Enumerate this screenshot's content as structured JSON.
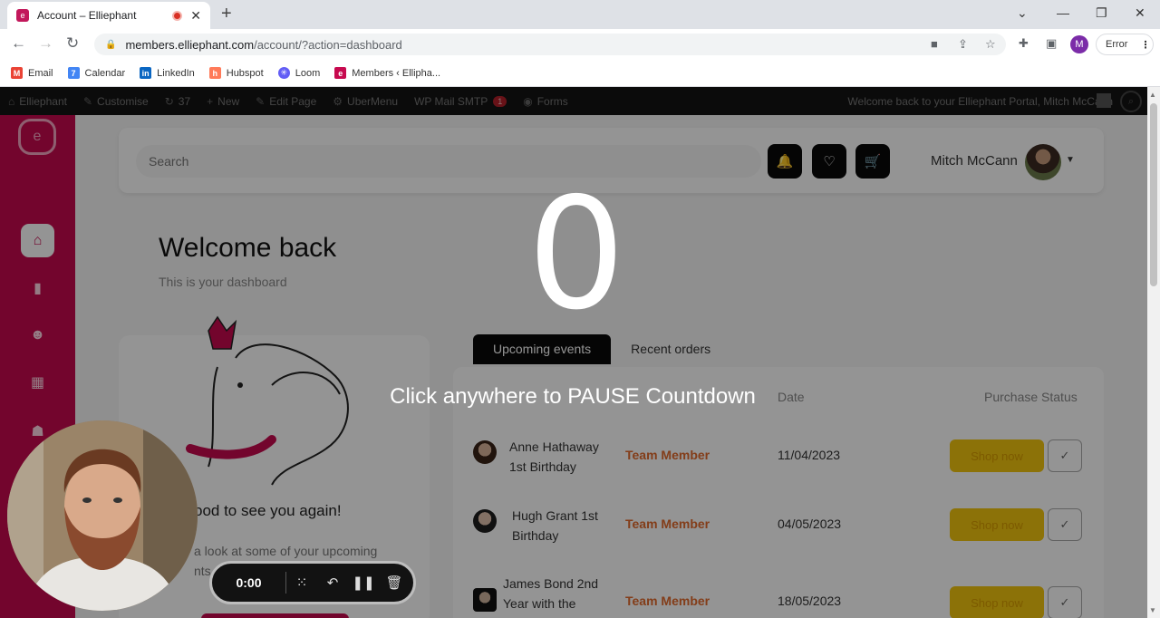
{
  "browser": {
    "tab_title": "Account – Elliephant",
    "new_tab": "+",
    "url_host": "members.elliephant.com",
    "url_path": "/account/?action=dashboard",
    "profile_initial": "M",
    "error_label": "Error",
    "bookmarks": [
      {
        "label": "Email",
        "icon": "gmail-icon",
        "color": "#ea4335"
      },
      {
        "label": "Calendar",
        "icon": "calendar-icon",
        "color": "#4285f4"
      },
      {
        "label": "LinkedIn",
        "icon": "linkedin-icon",
        "color": "#0a66c2"
      },
      {
        "label": "Hubspot",
        "icon": "hubspot-icon",
        "color": "#ff7a59"
      },
      {
        "label": "Loom",
        "icon": "loom-icon",
        "color": "#625df5"
      },
      {
        "label": "Members ‹ Ellipha...",
        "icon": "elliephant-icon",
        "color": "#c70a4f"
      }
    ]
  },
  "wp_admin_bar": {
    "site": "Elliephant",
    "customise": "Customise",
    "updates": "37",
    "new": "New",
    "edit_page": "Edit Page",
    "ubermenu": "UberMenu",
    "wp_mail_smtp": "WP Mail SMTP",
    "wp_mail_count": "1",
    "forms": "Forms",
    "welcome": "Welcome back to your Elliephant Portal, Mitch McCann"
  },
  "header": {
    "search_placeholder": "Search",
    "user_name": "Mitch McCann"
  },
  "main": {
    "welcome_title": "Welcome back",
    "welcome_subtitle": "This is your dashboard",
    "good_to_see": "ood to see you again!",
    "look_at": "a look at some of your upcoming",
    "look_at_2": "nts an"
  },
  "events": {
    "tabs": [
      "Upcoming events",
      "Recent orders"
    ],
    "columns": {
      "date": "Date",
      "status": "Purchase Status"
    },
    "shop_label": "Shop now",
    "rows": [
      {
        "name": "Anne Hathaway 1st Birthday",
        "role": "Team Member",
        "date": "11/04/2023"
      },
      {
        "name": "Hugh Grant 1st Birthday",
        "role": "Team Member",
        "date": "04/05/2023"
      },
      {
        "name": "James Bond 2nd Year with the",
        "role": "Team Member",
        "date": "18/05/2023"
      }
    ]
  },
  "overlay": {
    "countdown": "0",
    "message": "Click anywhere to PAUSE Countdown"
  },
  "recorder": {
    "time": "0:00"
  },
  "colors": {
    "brand": "#c70a4f",
    "accent_yellow": "#f2c40f",
    "role_orange": "#e26a2c"
  }
}
